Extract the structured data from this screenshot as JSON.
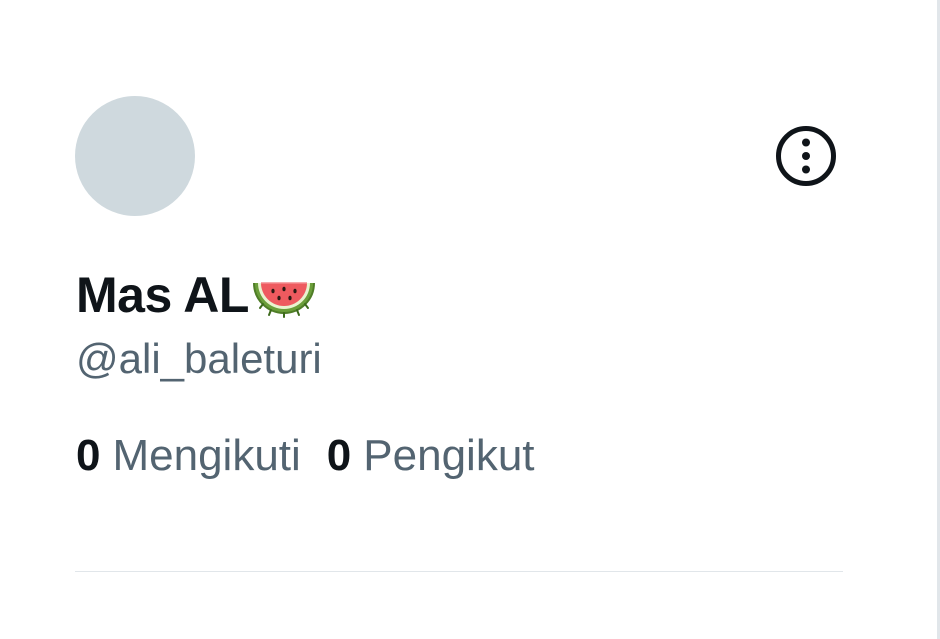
{
  "profile": {
    "display_name": "Mas AL",
    "name_emoji": "watermelon-icon",
    "handle": "@ali_baleturi",
    "avatar_color": "#cfd9de"
  },
  "stats": {
    "following_count": "0",
    "following_label": "Mengikuti",
    "followers_count": "0",
    "followers_label": "Pengikut"
  },
  "colors": {
    "primary_text": "#0f1419",
    "secondary_text": "#536471",
    "divider": "#e1e6ea"
  },
  "icons": {
    "more": "more-options-icon"
  }
}
